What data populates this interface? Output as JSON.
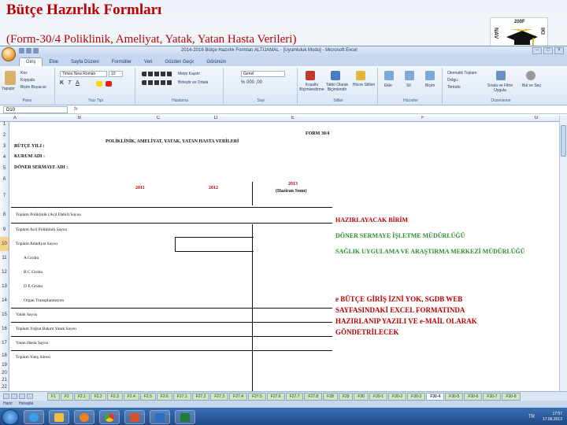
{
  "slide": {
    "title": "Bütçe Hazırlık Formları",
    "subtitle": "(Form-30/4 Poliklinik, Ameliyat, Yatak, Yatan Hasta Verileri)",
    "logo_year": "200F",
    "logo_left": "NAV",
    "logo_right": "IKI"
  },
  "excel": {
    "window_title": "2014-2016 Bütçe Hazırlık Formları ALTIJAMAL - [Uyumluluk Modu] - Microsoft Excel",
    "tabs": [
      "Giriş",
      "Ekle",
      "Sayfa Düzeni",
      "Formüller",
      "Veri",
      "Gözden Geçir",
      "Görünüm"
    ],
    "ribbon": {
      "clipboard": {
        "cut": "Kes",
        "copy": "Kopyala",
        "format_painter": "Biçim Boyacısı",
        "paste": "Yapıştır",
        "label": "Pano"
      },
      "font": {
        "name": "Times New Roman",
        "size": "10",
        "label": "Yazı Tipi"
      },
      "alignment": {
        "wrap": "Metni Kaydır",
        "merge": "Birleştir ve Ortala",
        "label": "Hizalama"
      },
      "number": {
        "format": "Genel",
        "label": "Sayı"
      },
      "styles": {
        "conditional": "Koşullu Biçimlendirme",
        "as_table": "Tablo Olarak Biçimlendir",
        "cell_styles": "Hücre Stilleri",
        "label": "Stiller"
      },
      "cells": {
        "insert": "Ekle",
        "delete": "Sil",
        "format": "Biçim",
        "label": "Hücreler"
      },
      "editing": {
        "autosum": "Otomatik Toplam",
        "fill": "Dolgu",
        "clear": "Temizle",
        "sort": "Sırala ve Filtre Uygula",
        "find": "Bul ve Seç",
        "label": "Düzenleme"
      }
    },
    "name_box": "D10",
    "fx": "fx",
    "columns": [
      "A",
      "B",
      "C",
      "D",
      "E",
      "F",
      "G"
    ],
    "rows": [
      "1",
      "2",
      "3",
      "4",
      "5",
      "6",
      "7",
      "8",
      "9",
      "10",
      "11",
      "12",
      "13",
      "14",
      "15",
      "16",
      "17",
      "18",
      "19",
      "20",
      "21",
      "22"
    ],
    "form": {
      "form_no": "FORM 30/4",
      "heading": "POLİKLİNİK, AMELİYAT, YATAK, YATAN HASTA VERİLERİ",
      "budget_year": "BÜTÇE YILI :",
      "institution": "KURUM ADI :",
      "fund": "DÖNER SERMAYE ADI :",
      "years": [
        "2011",
        "2012",
        "2013"
      ],
      "year_note": "(Haziran Sonu)",
      "items": [
        "Toplam Poliklinik (Acil Dahil) Sayısı",
        "Toplam Acil Poliklinik Sayısı",
        "Toplam Ameliyat Sayısı",
        "A Grubu",
        "B C Grubu",
        "D E Grubu",
        "Organ Transplantasyon",
        "Yatak Sayısı",
        "Toplam Yoğun Bakım Yatak Sayısı",
        "Yatan Hasta Sayısı",
        "Toplam Yatış Süresi"
      ]
    },
    "notes": {
      "prepared_by": "HAZIRLAYACAK BİRİM",
      "unit1": "DÖNER SERMAYE İŞLETME MÜDÜRLÜĞÜ",
      "unit2": "SAĞLIK UYGULAMA VE ARAŞTIRMA MERKEZİ MÜDÜRLÜĞÜ",
      "instruction": [
        "e BÜTÇE GİRİŞ İZNİ YOK, SGDB WEB",
        "SAYFASINDAKİ EXCEL FORMATINDA",
        "HAZIRLANIP YAZILI VE e-MAİL OLARAK",
        "GÖNDETRİLECEK"
      ]
    },
    "sheet_tabs": [
      "F1",
      "F2",
      "F2.1",
      "F2.2",
      "F2.3",
      "F2.4",
      "F2.5",
      "F2.6",
      "F27.1",
      "F27.2",
      "F27.3",
      "F27.4",
      "F27.5",
      "F27.6",
      "F27.7",
      "F27.8",
      "F28",
      "F29",
      "F30",
      "F30-1",
      "F30-2",
      "F30-3",
      "F30-4",
      "F30-5",
      "F30-6",
      "F30-7",
      "F30-8"
    ],
    "active_sheet": "F30-4",
    "status": {
      "ready": "Hazır",
      "calc": "Hesapla"
    },
    "clock": {
      "time": "17:57",
      "date": "17.06.2013"
    },
    "tray_lang": "TR"
  },
  "colors": {
    "title_red": "#c00000",
    "note_green": "#2e8b2e",
    "ribbon_blue": "#c6d7ef",
    "taskbar": "#1d4784"
  }
}
